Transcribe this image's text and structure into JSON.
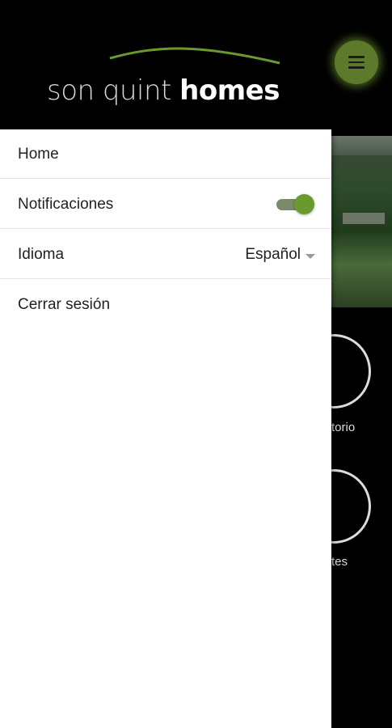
{
  "header": {
    "logo_light": "son quint",
    "logo_bold": "homes"
  },
  "drawer": {
    "items": [
      {
        "label": "Home"
      },
      {
        "label": "Notificaciones",
        "toggle_on": true
      },
      {
        "label": "Idioma",
        "value": "Español"
      },
      {
        "label": "Cerrar sesión"
      }
    ]
  },
  "background": {
    "label_1": "torio",
    "label_2": "tes"
  },
  "colors": {
    "accent": "#6a9a2e",
    "menu_button": "#5d7a2a",
    "header_bg": "#000000"
  }
}
